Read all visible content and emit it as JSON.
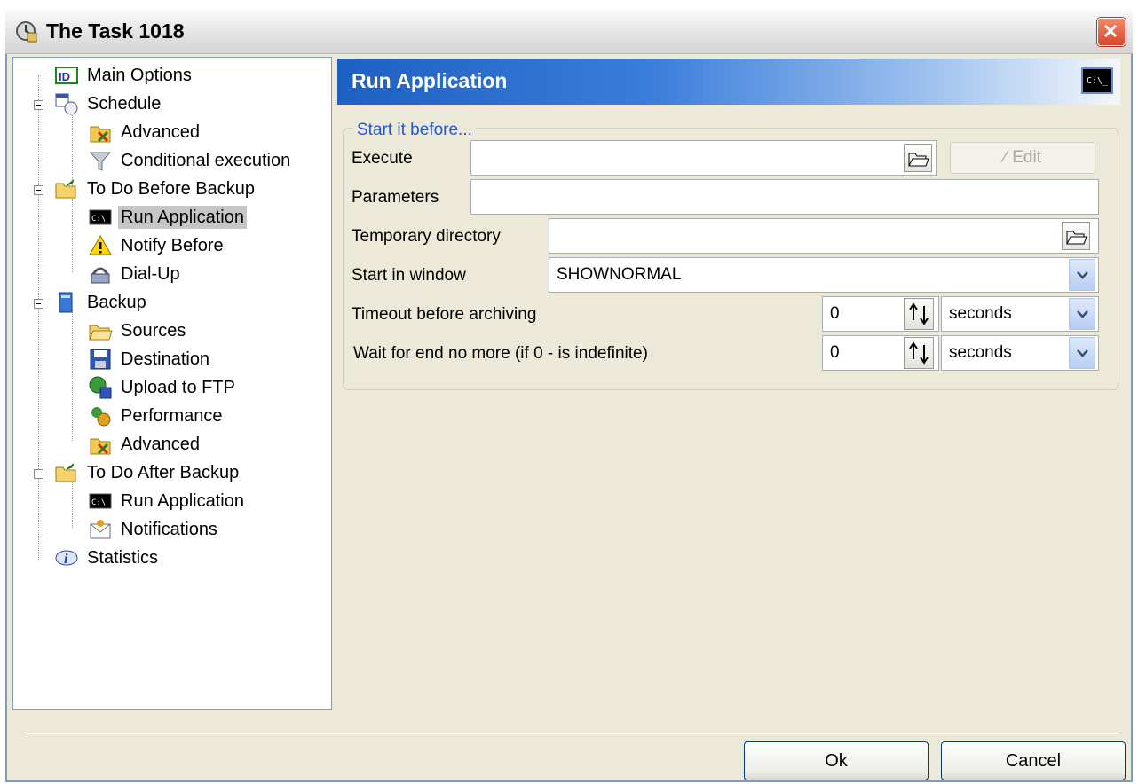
{
  "window": {
    "title": "The Task 1018"
  },
  "tree": {
    "items": [
      {
        "label": "Main Options",
        "icon": "id-icon"
      },
      {
        "label": "Schedule",
        "icon": "calendar-clock-icon"
      },
      {
        "label": "Advanced",
        "icon": "advanced-settings-icon"
      },
      {
        "label": "Conditional execution",
        "icon": "filter-icon"
      },
      {
        "label": "To Do Before Backup",
        "icon": "folder-arrow-icon"
      },
      {
        "label": "Run Application",
        "icon": "console-icon",
        "selected": true
      },
      {
        "label": "Notify Before",
        "icon": "warning-icon"
      },
      {
        "label": "Dial-Up",
        "icon": "dialup-icon"
      },
      {
        "label": "Backup",
        "icon": "computer-icon"
      },
      {
        "label": "Sources",
        "icon": "folder-open-icon"
      },
      {
        "label": "Destination",
        "icon": "floppy-icon"
      },
      {
        "label": "Upload to FTP",
        "icon": "globe-upload-icon"
      },
      {
        "label": "Performance",
        "icon": "performance-icon"
      },
      {
        "label": "Advanced",
        "icon": "advanced-settings-icon"
      },
      {
        "label": "To Do After Backup",
        "icon": "folder-arrow-icon"
      },
      {
        "label": "Run Application",
        "icon": "console-icon"
      },
      {
        "label": "Notifications",
        "icon": "envelope-icon"
      },
      {
        "label": "Statistics",
        "icon": "info-icon"
      }
    ]
  },
  "panel": {
    "title": "Run Application",
    "header_icon_text": "C:\\_",
    "group_caption": "Start it before...",
    "execute": {
      "label": "Execute",
      "value": "",
      "edit_label": "Edit"
    },
    "parameters": {
      "label": "Parameters",
      "value": ""
    },
    "temp_dir": {
      "label": "Temporary directory",
      "value": ""
    },
    "start_in_window": {
      "label": "Start in window",
      "value": "SHOWNORMAL"
    },
    "timeout": {
      "label": "Timeout before archiving",
      "value": "0",
      "unit": "seconds"
    },
    "wait": {
      "label": "Wait for end no more (if 0 - is indefinite)",
      "value": "0",
      "unit": "seconds"
    }
  },
  "buttons": {
    "ok": "Ok",
    "cancel": "Cancel"
  },
  "colors": {
    "accent": "#2255d0",
    "header_start": "#1e5fc3",
    "selection": "#c6c6c6",
    "close": "#d9482a"
  }
}
